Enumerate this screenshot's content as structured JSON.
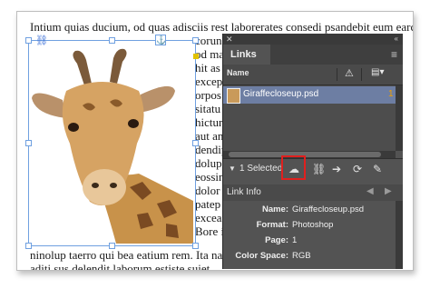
{
  "document": {
    "lines": [
      "Intium quias ducium, od quas adisciis rest laborerates consedi psandebit eum earcimu",
      "corun",
      "od ma",
      "hit as",
      "excep",
      "orpos",
      "sitatu",
      "hictur",
      "aut an",
      "dendip",
      "dolup",
      "eossin",
      "dolor",
      "patep",
      "exceat",
      "Bore i",
      "ninolup taerro qui bea eatium rem. Ita nat",
      "aditi sus delendit laborum estiste suiet"
    ]
  },
  "links_panel": {
    "tab_label": "Links",
    "column_name": "Name",
    "warning_icon": "warning-icon",
    "page_icon": "page-icon",
    "items": [
      {
        "filename": "Giraffecloseup.psd",
        "page": "1"
      }
    ],
    "selected_count": "1 Selected",
    "toolbar_buttons": [
      "cc-libraries-icon",
      "relink-icon",
      "goto-link-icon",
      "update-link-icon",
      "edit-original-icon"
    ],
    "link_info": {
      "title": "Link Info",
      "fields": [
        {
          "label": "Name:",
          "value": "Giraffecloseup.psd"
        },
        {
          "label": "Format:",
          "value": "Photoshop"
        },
        {
          "label": "Page:",
          "value": "1"
        },
        {
          "label": "Color Space:",
          "value": "RGB"
        }
      ]
    }
  },
  "colors": {
    "selected_row": "#6d7ea3",
    "highlight_box": "#e0201e",
    "frame_blue": "#6fa0e0",
    "page_number": "#f0a000"
  }
}
